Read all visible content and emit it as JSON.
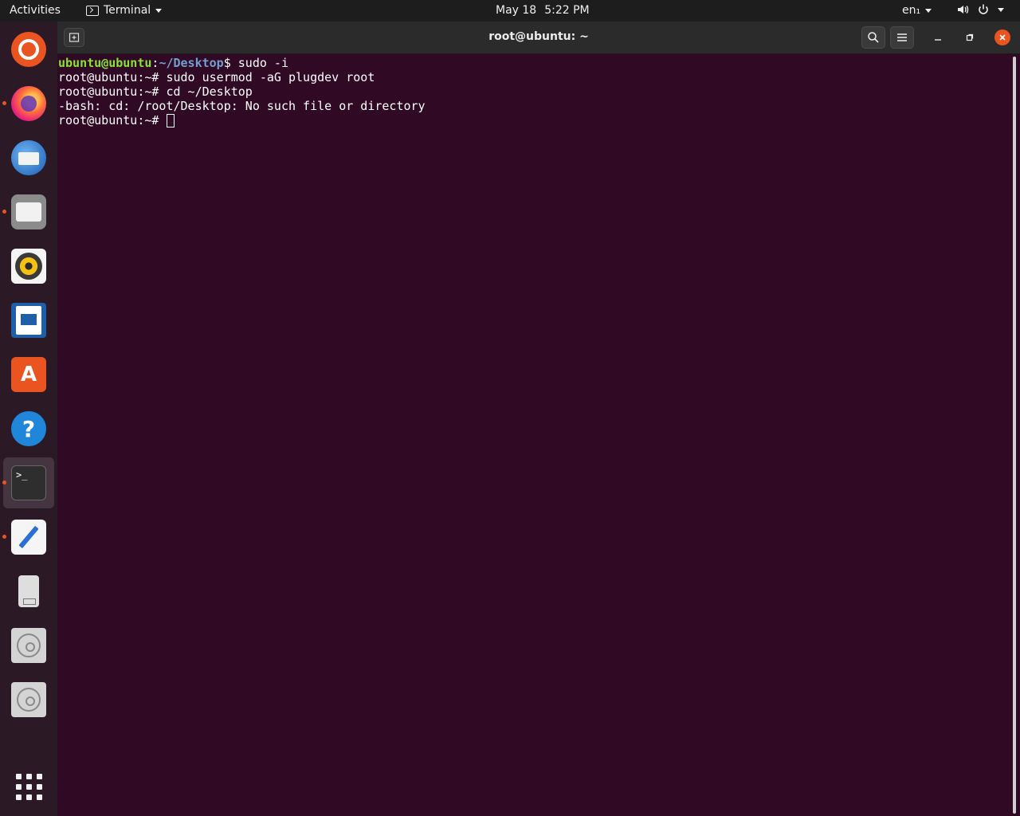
{
  "topbar": {
    "activities": "Activities",
    "app_name": "Terminal",
    "date": "May 18",
    "time": "5:22 PM",
    "language": "en₁"
  },
  "dock": {
    "items": [
      {
        "name": "Ubuntu",
        "icon": "ubuntu-logo-icon",
        "running": false
      },
      {
        "name": "Firefox",
        "icon": "firefox-icon",
        "running": true
      },
      {
        "name": "Thunderbird",
        "icon": "thunderbird-icon",
        "running": false
      },
      {
        "name": "Files",
        "icon": "files-icon",
        "running": true
      },
      {
        "name": "Rhythmbox",
        "icon": "rhythmbox-icon",
        "running": false
      },
      {
        "name": "LibreOffice Writer",
        "icon": "writer-icon",
        "running": false
      },
      {
        "name": "Ubuntu Software",
        "icon": "software-store-icon",
        "running": false
      },
      {
        "name": "Help",
        "icon": "help-icon",
        "running": false
      },
      {
        "name": "Terminal",
        "icon": "terminal-icon",
        "running": true,
        "active": true
      },
      {
        "name": "Text Editor",
        "icon": "text-editor-icon",
        "running": true
      },
      {
        "name": "USB Drive",
        "icon": "usb-drive-icon",
        "running": false
      },
      {
        "name": "Disk 1",
        "icon": "disk-icon",
        "running": false
      },
      {
        "name": "Disk 2",
        "icon": "disk-icon",
        "running": false
      },
      {
        "name": "Show Applications",
        "icon": "app-grid-icon",
        "running": false
      }
    ],
    "help_glyph": "?",
    "store_glyph": "A",
    "terminal_glyph": ">_"
  },
  "window": {
    "title": "root@ubuntu: ~"
  },
  "terminal": {
    "line1": {
      "user_host": "ubuntu@ubuntu",
      "colon": ":",
      "path": "~/Desktop",
      "suffix": "$ sudo -i"
    },
    "line2": "root@ubuntu:~# sudo usermod -aG plugdev root",
    "line3": "root@ubuntu:~# cd ~/Desktop",
    "line4": "-bash: cd: /root/Desktop: No such file or directory",
    "line5_prompt": "root@ubuntu:~# "
  },
  "colors": {
    "terminal_bg": "#300a24",
    "accent": "#e95420",
    "prompt_user": "#8ae234",
    "prompt_path": "#729fcf"
  }
}
